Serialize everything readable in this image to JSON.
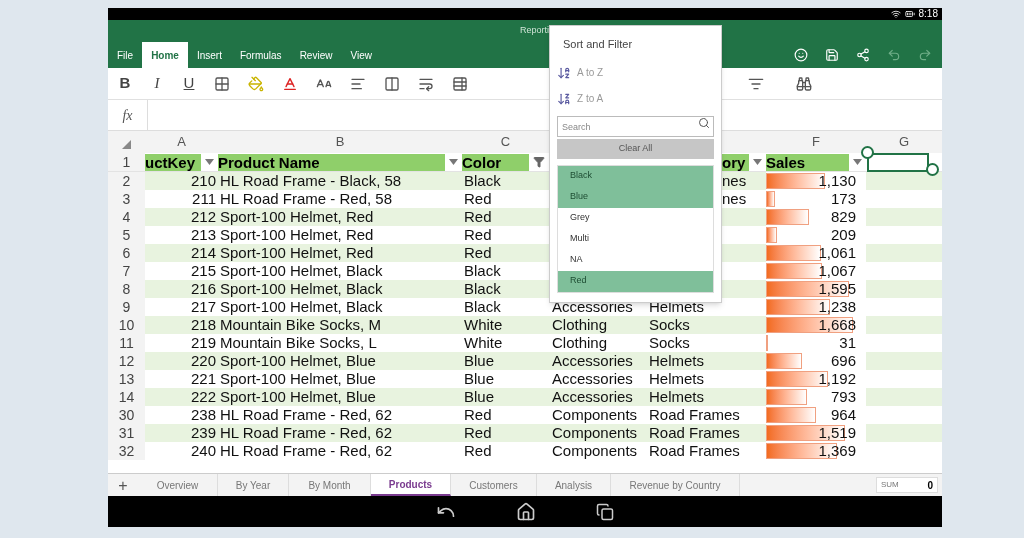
{
  "status_bar": {
    "time": "8:18"
  },
  "ribbon": {
    "title": "Reporti",
    "tabs": [
      {
        "label": "File",
        "selected": false
      },
      {
        "label": "Home",
        "selected": true
      },
      {
        "label": "Insert",
        "selected": false
      },
      {
        "label": "Formulas",
        "selected": false
      },
      {
        "label": "Review",
        "selected": false
      },
      {
        "label": "View",
        "selected": false
      }
    ]
  },
  "toolbar": {
    "format_buttons": [
      {
        "kind": "bold",
        "label": "B"
      },
      {
        "kind": "italic",
        "label": "I"
      },
      {
        "kind": "underline",
        "label": "U"
      }
    ]
  },
  "formula_bar": {
    "label": "fx"
  },
  "grid": {
    "column_letters": [
      "A",
      "B",
      "C",
      "F",
      "G"
    ],
    "header_row": {
      "number": "1",
      "cells": [
        {
          "text": "uctKey",
          "kind": "dropdown"
        },
        {
          "text": "Product Name",
          "kind": "dropdown"
        },
        {
          "text": "Color",
          "kind": "filtered"
        },
        {
          "text": "ory",
          "kind": "dropdown"
        },
        {
          "text": "Sales",
          "kind": "dropdown"
        }
      ]
    },
    "rows": [
      {
        "number": "2",
        "key": "210",
        "name": "HL Road Frame - Black, 58",
        "product_color": "Black",
        "subcategory": "nes",
        "sales": "1,130",
        "level": 0.59
      },
      {
        "number": "3",
        "key": "211",
        "name": "HL Road Frame - Red, 58",
        "product_color": "Red",
        "subcategory": "nes",
        "sales": "173",
        "level": 0.09
      },
      {
        "number": "4",
        "key": "212",
        "name": "Sport-100 Helmet, Red",
        "product_color": "Red",
        "sales": "829",
        "level": 0.43
      },
      {
        "number": "5",
        "key": "213",
        "name": "Sport-100 Helmet, Red",
        "product_color": "Red",
        "sales": "209",
        "level": 0.11
      },
      {
        "number": "6",
        "key": "214",
        "name": "Sport-100 Helmet, Red",
        "product_color": "Red",
        "sales": "1,061",
        "level": 0.55
      },
      {
        "number": "7",
        "key": "215",
        "name": "Sport-100 Helmet, Black",
        "product_color": "Black",
        "sales": "1,067",
        "level": 0.56
      },
      {
        "number": "8",
        "key": "216",
        "name": "Sport-100 Helmet, Black",
        "product_color": "Black",
        "sales": "1,595",
        "level": 0.83
      },
      {
        "number": "9",
        "key": "217",
        "name": "Sport-100 Helmet, Black",
        "product_color": "Black",
        "category": "Accessories",
        "subcategory": "Helmets",
        "sales": "1,238",
        "level": 0.64
      },
      {
        "number": "10",
        "key": "218",
        "name": "Mountain Bike Socks, M",
        "product_color": "White",
        "category": "Clothing",
        "subcategory": "Socks",
        "sales": "1,668",
        "level": 0.87
      },
      {
        "number": "11",
        "key": "219",
        "name": "Mountain Bike Socks, L",
        "product_color": "White",
        "category": "Clothing",
        "subcategory": "Socks",
        "sales": "31",
        "level": 0.02
      },
      {
        "number": "12",
        "key": "220",
        "name": "Sport-100 Helmet, Blue",
        "product_color": "Blue",
        "category": "Accessories",
        "subcategory": "Helmets",
        "sales": "696",
        "level": 0.36
      },
      {
        "number": "13",
        "key": "221",
        "name": "Sport-100 Helmet, Blue",
        "product_color": "Blue",
        "category": "Accessories",
        "subcategory": "Helmets",
        "sales": "1,192",
        "level": 0.62
      },
      {
        "number": "14",
        "key": "222",
        "name": "Sport-100 Helmet, Blue",
        "product_color": "Blue",
        "category": "Accessories",
        "subcategory": "Helmets",
        "sales": "793",
        "level": 0.41
      },
      {
        "number": "30",
        "key": "238",
        "name": "HL Road Frame - Red, 62",
        "product_color": "Red",
        "category": "Components",
        "subcategory": "Road Frames",
        "sales": "964",
        "level": 0.5
      },
      {
        "number": "31",
        "key": "239",
        "name": "HL Road Frame - Red, 62",
        "product_color": "Red",
        "category": "Components",
        "subcategory": "Road Frames",
        "sales": "1,519",
        "level": 0.79
      },
      {
        "number": "32",
        "key": "240",
        "name": "HL Road Frame - Red, 62",
        "product_color": "Red",
        "category": "Components",
        "subcategory": "Road Frames",
        "sales": "1,369",
        "level": 0.71
      }
    ]
  },
  "sort_filter": {
    "title": "Sort and Filter",
    "sort_options": [
      {
        "kind": "ascending",
        "label": "A to Z"
      },
      {
        "kind": "descending",
        "label": "Z to A"
      }
    ],
    "search_placeholder": "Search",
    "clear_button": "Clear All",
    "items": [
      {
        "label": "Black",
        "selected": true
      },
      {
        "label": "Blue",
        "selected": true
      },
      {
        "label": "Grey",
        "selected": false
      },
      {
        "label": "Multi",
        "selected": false
      },
      {
        "label": "NA",
        "selected": false
      },
      {
        "label": "Red",
        "selected": true
      }
    ]
  },
  "sheet_tabs": [
    {
      "label": "Overview",
      "selected": false
    },
    {
      "label": "By Year",
      "selected": false
    },
    {
      "label": "By Month",
      "selected": false
    },
    {
      "label": "Products",
      "selected": true
    },
    {
      "label": "Customers",
      "selected": false
    },
    {
      "label": "Analysis",
      "selected": false
    },
    {
      "label": "Revenue by Country",
      "selected": false
    }
  ],
  "add_sheet": "+",
  "sum": {
    "label": "SUM",
    "value": "0"
  }
}
